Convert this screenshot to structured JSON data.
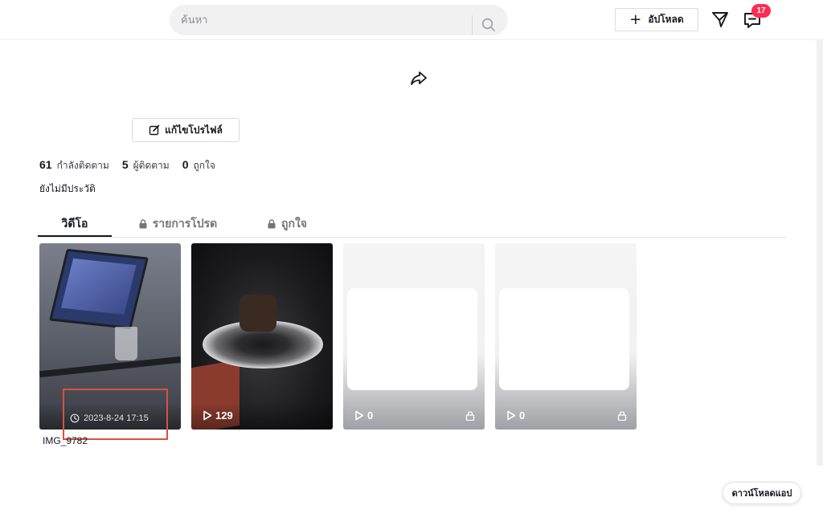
{
  "header": {
    "search_placeholder": "ค้นหา",
    "upload_label": "อัปโหลด",
    "inbox_badge": "17"
  },
  "profile": {
    "edit_label": "แก้ไขโปรไฟล์",
    "stats": [
      {
        "value": "61",
        "label": "กำลังติดตาม"
      },
      {
        "value": "5",
        "label": "ผู้ติดตาม"
      },
      {
        "value": "0",
        "label": "ถูกใจ"
      }
    ],
    "bio": "ยังไม่มีประวัติ"
  },
  "tabs": [
    {
      "label": "วิดีโอ",
      "locked": false,
      "active": true
    },
    {
      "label": "รายการโปรด",
      "locked": true,
      "active": false
    },
    {
      "label": "ถูกใจ",
      "locked": true,
      "active": false
    }
  ],
  "videos": [
    {
      "timestamp": "2023-8-24 17:15",
      "caption": "IMG_9782"
    },
    {
      "views": "129"
    },
    {
      "views": "0",
      "locked": true
    },
    {
      "views": "0",
      "locked": true
    }
  ],
  "footer": {
    "download_app_label": "ดาวน์โหลดแอป"
  },
  "colors": {
    "accent": "#fe2c55",
    "highlight": "#d9513f",
    "text": "#161823"
  }
}
